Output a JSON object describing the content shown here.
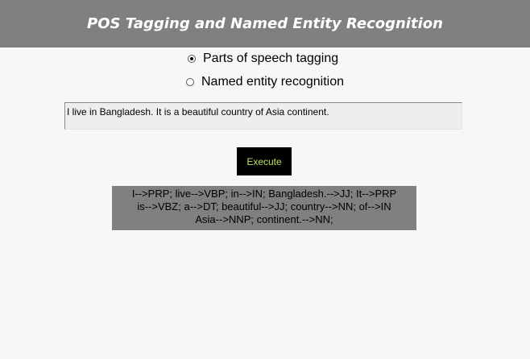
{
  "header": {
    "title": "POS Tagging and Named Entity Recognition"
  },
  "options": [
    {
      "label": "Parts of speech tagging",
      "selected": true
    },
    {
      "label": "Named entity recognition",
      "selected": false
    }
  ],
  "input": {
    "value": "I live in Bangladesh. It is a beautiful country of Asia continent."
  },
  "execute": {
    "label": "Execute"
  },
  "output": {
    "lines": [
      "I-->PRP; live-->VBP; in-->IN; Bangladesh.-->JJ; It-->PRP",
      "is-->VBZ; a-->DT; beautiful-->JJ; country-->NN; of-->IN",
      "Asia-->NNP; continent.-->NN;"
    ]
  },
  "colors": {
    "header_bg": "#808080",
    "button_text": "#b6e05a",
    "output_bg": "#808080"
  }
}
